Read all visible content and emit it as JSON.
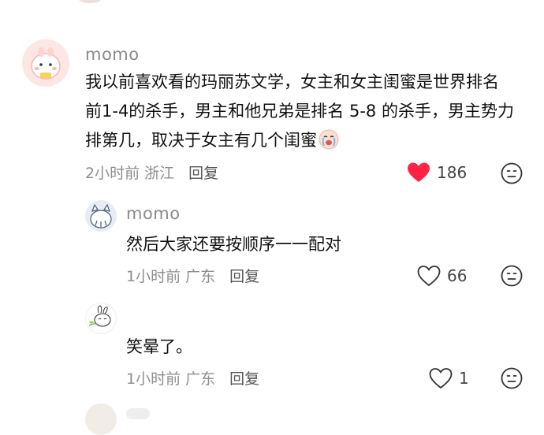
{
  "comments": [
    {
      "username": "momo",
      "text": "我以前喜欢看的玛丽苏文学，女主和女主闺蜜是世界排名前1-4的杀手，男主和他兄弟是排名 5-8 的杀手，男主势力排第几，取决于女主有几个闺蜜",
      "emoji": "crying-face-emoji",
      "time": "2小时前",
      "location": "浙江",
      "reply_label": "回复",
      "likes": "186",
      "liked": true
    },
    {
      "username": "momo",
      "text": "然后大家还要按顺序一一配对",
      "time": "1小时前",
      "location": "广东",
      "reply_label": "回复",
      "likes": "66",
      "liked": false
    },
    {
      "username": "",
      "text": "笑晕了。",
      "time": "1小时前",
      "location": "广东",
      "reply_label": "回复",
      "likes": "1",
      "liked": false
    }
  ],
  "colors": {
    "liked_heart": "#ff2442",
    "username": "#8a8a8a",
    "meta": "#8e8e8e"
  }
}
